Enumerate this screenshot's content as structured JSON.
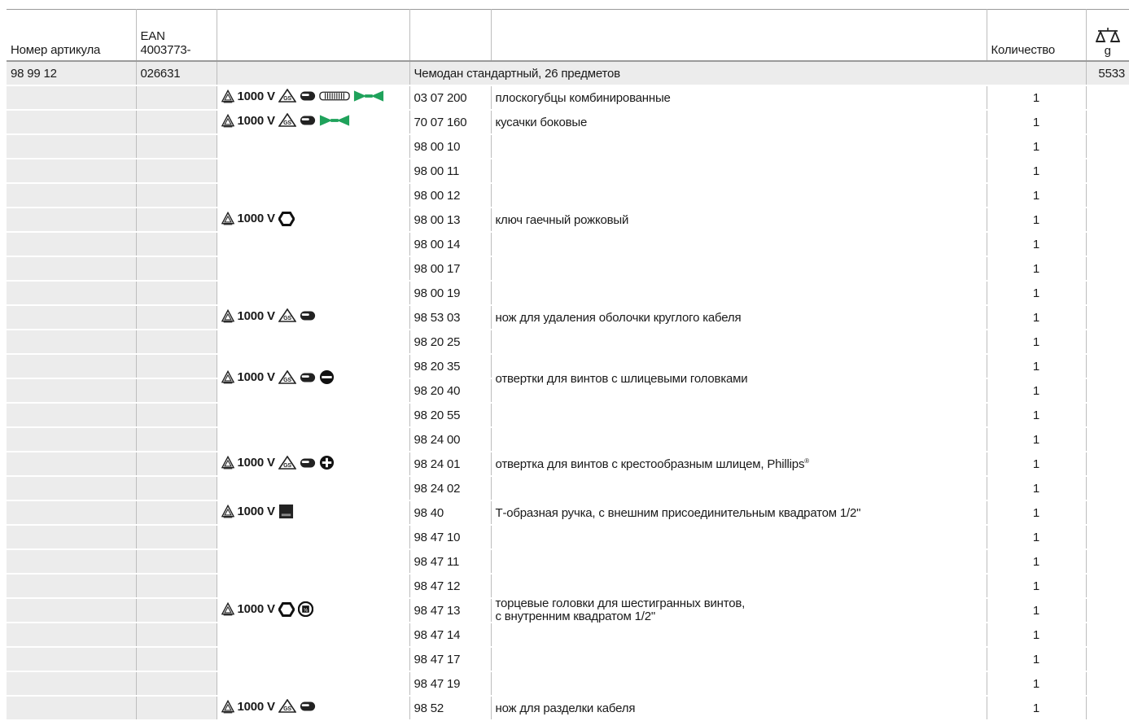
{
  "header": {
    "col_article": "Номер артикула",
    "col_ean": "EAN 4003773-",
    "col_qty": "Количество",
    "col_weight_unit": "g",
    "weight_icon": "scale-icon"
  },
  "kit": {
    "article": "98 99 12",
    "ean": "026631",
    "name": "Чемодан стандартный, 26 предметов",
    "weight": "5533"
  },
  "voltage": "1000 V",
  "icons": {
    "vde": "vde-triangle-icon",
    "gs": "gs-mark-icon",
    "handle": "two-component-handle-icon",
    "grip": "grip-zone-icon",
    "cutter": "cutting-edge-icon",
    "hex": "hexagon-icon",
    "slot": "slotted-screw-icon",
    "phillips": "phillips-screw-icon",
    "square": "square-drive-icon",
    "square_half": "half-inch-square-icon"
  },
  "items": [
    {
      "code": "03 07 200",
      "qty": "1"
    },
    {
      "code": "70 07 160",
      "qty": "1"
    },
    {
      "code": "98 00 10",
      "qty": "1"
    },
    {
      "code": "98 00 11",
      "qty": "1"
    },
    {
      "code": "98 00 12",
      "qty": "1"
    },
    {
      "code": "98 00 13",
      "qty": "1"
    },
    {
      "code": "98 00 14",
      "qty": "1"
    },
    {
      "code": "98 00 17",
      "qty": "1"
    },
    {
      "code": "98 00 19",
      "qty": "1"
    },
    {
      "code": "98 53 03",
      "qty": "1"
    },
    {
      "code": "98 20 25",
      "qty": "1"
    },
    {
      "code": "98 20 35",
      "qty": "1"
    },
    {
      "code": "98 20 40",
      "qty": "1"
    },
    {
      "code": "98 20 55",
      "qty": "1"
    },
    {
      "code": "98 24 00",
      "qty": "1"
    },
    {
      "code": "98 24 01",
      "qty": "1"
    },
    {
      "code": "98 24 02",
      "qty": "1"
    },
    {
      "code": "98 40",
      "qty": "1"
    },
    {
      "code": "98 47 10",
      "qty": "1"
    },
    {
      "code": "98 47 11",
      "qty": "1"
    },
    {
      "code": "98 47 12",
      "qty": "1"
    },
    {
      "code": "98 47 13",
      "qty": "1"
    },
    {
      "code": "98 47 14",
      "qty": "1"
    },
    {
      "code": "98 47 17",
      "qty": "1"
    },
    {
      "code": "98 47 19",
      "qty": "1"
    },
    {
      "code": "98 52",
      "qty": "1"
    }
  ],
  "descriptions": {
    "pliers": "плоскогубцы комбинированные",
    "side_cutters": "кусачки боковые",
    "open_wrench": "ключ гаечный рожковый",
    "cable_knife_round": "нож для удаления оболочки круглого кабеля",
    "slot_screwdrivers": "отвертки для винтов с шлицевыми головками",
    "phillips_screwdriver": "отвертка для винтов с крестообразным шлицем, Phillips",
    "phillips_reg": "®",
    "t_handle": "Т-образная ручка, с внешним присоединительным квадратом 1/2\"",
    "sockets_line1": "торцевые головки для шестигранных винтов,",
    "sockets_line2": "с внутренним квадратом 1/2\"",
    "cable_knife": "нож для разделки кабеля"
  }
}
